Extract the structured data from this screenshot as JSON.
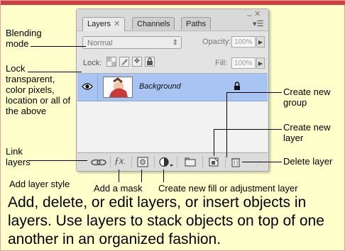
{
  "panel": {
    "tabs": [
      {
        "label": "Layers",
        "close": "✕"
      },
      {
        "label": "Channels"
      },
      {
        "label": "Paths"
      }
    ],
    "blend_mode": "Normal",
    "opacity_label": "Opacity:",
    "opacity_value": "100%",
    "lock_label": "Lock:",
    "fill_label": "Fill:",
    "fill_value": "100%",
    "layer": {
      "name": "Background"
    }
  },
  "annotations": {
    "blending_mode": "Blending mode",
    "lock": "Lock transparent, color pixels, location or all of the above",
    "link_layers": "Link layers",
    "create_group": "Create new group",
    "create_layer": "Create new layer",
    "delete_layer": "Delete layer",
    "add_style": "Add layer style",
    "add_mask": "Add a mask",
    "new_fill": "Create new fill or adjustment layer"
  },
  "caption": "Add, delete, or edit layers, or insert objects in layers. Use layers to stack objects on top of one another in an organized fashion.",
  "colors": {
    "background": "#ffffcc",
    "accent": "#d04040",
    "selected_layer": "#a7c4f2"
  }
}
